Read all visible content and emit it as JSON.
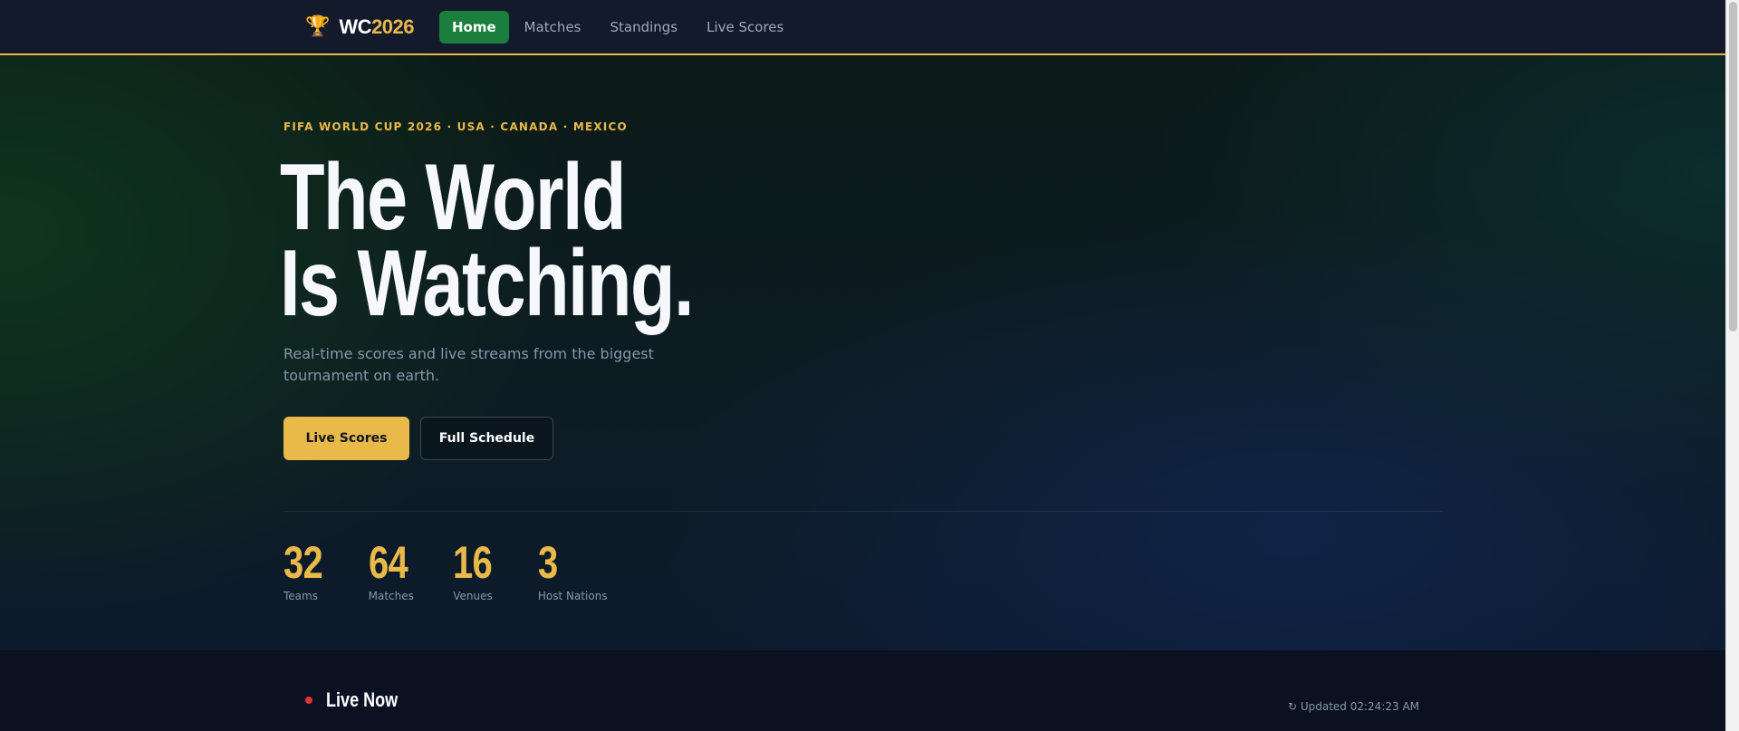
{
  "nav": {
    "logo_icon": "🏆",
    "logo_prefix": "WC",
    "logo_year": "2026",
    "links": [
      {
        "label": "Home",
        "active": true
      },
      {
        "label": "Matches",
        "active": false
      },
      {
        "label": "Standings",
        "active": false
      },
      {
        "label": "Live Scores",
        "active": false
      }
    ]
  },
  "hero": {
    "eyebrow": "FIFA WORLD CUP 2026 · USA · CANADA · MEXICO",
    "headline_line1": "The World",
    "headline_line2": "Is Watching.",
    "subtitle": "Real-time scores and live streams from the biggest tournament on earth.",
    "primary_button": "Live Scores",
    "secondary_button": "Full Schedule",
    "stats": [
      {
        "value": "32",
        "label": "Teams"
      },
      {
        "value": "64",
        "label": "Matches"
      },
      {
        "value": "16",
        "label": "Venues"
      },
      {
        "value": "3",
        "label": "Host Nations"
      }
    ]
  },
  "live": {
    "title": "Live Now",
    "updated": "↻ Updated 02:24:23 AM"
  },
  "colors": {
    "accent": "#e9b949",
    "active_nav": "#1a7f3c",
    "live_dot": "#e0323c",
    "nav_bg": "#121a2b"
  }
}
